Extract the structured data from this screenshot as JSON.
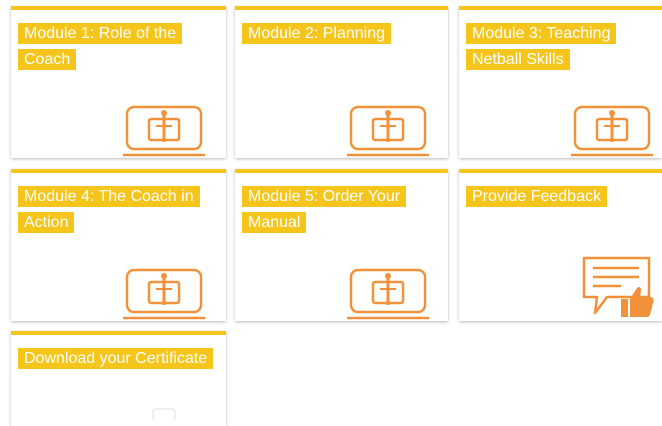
{
  "tiles": [
    {
      "title": "Module 1: Role of the Coach",
      "icon": "module-book-icon"
    },
    {
      "title": "Module 2: Planning",
      "icon": "module-book-icon"
    },
    {
      "title": "Module 3: Teaching Netball Skills",
      "icon": "module-book-icon"
    },
    {
      "title": "Module 4: The Coach in Action",
      "icon": "module-book-icon"
    },
    {
      "title": "Module 5: Order Your Manual",
      "icon": "module-book-icon"
    },
    {
      "title": "Provide Feedback",
      "icon": "feedback-thumbs-up-icon"
    },
    {
      "title": "Download your Certificate",
      "icon": "certificate-icon"
    }
  ],
  "colors": {
    "accent": "#f6c51b",
    "icon": "#f2913a"
  }
}
